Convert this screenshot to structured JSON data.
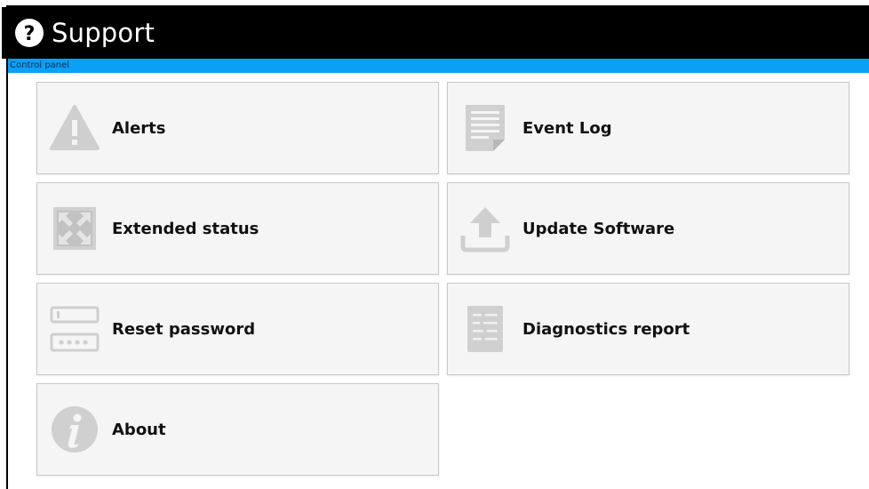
{
  "header": {
    "title": "Support",
    "icon": "help-icon"
  },
  "breadcrumb": {
    "text": "Control panel"
  },
  "tiles": [
    {
      "label": "Alerts",
      "icon": "warning-icon"
    },
    {
      "label": "Event Log",
      "icon": "document-icon"
    },
    {
      "label": "Extended status",
      "icon": "expand-icon"
    },
    {
      "label": "Update Software",
      "icon": "upload-icon"
    },
    {
      "label": "Reset password",
      "icon": "password-field-icon"
    },
    {
      "label": "Diagnostics report",
      "icon": "report-icon"
    },
    {
      "label": "About",
      "icon": "info-icon"
    }
  ],
  "colors": {
    "header_bg": "#000000",
    "breadcrumb_bg": "#0aa0f4",
    "tile_bg": "#f5f5f5",
    "icon_gray": "#d0d0d0"
  }
}
